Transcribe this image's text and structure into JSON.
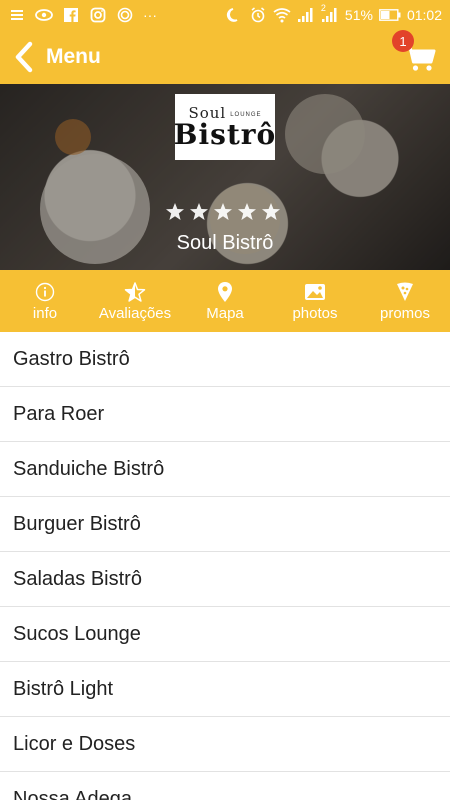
{
  "status_bar": {
    "battery_percent": "51%",
    "time": "01:02",
    "dots": "···",
    "sim_badge": "2"
  },
  "app_bar": {
    "title": "Menu",
    "cart_count": "1"
  },
  "hero": {
    "logo_top": "Soul",
    "logo_lounge": "LOUNGE",
    "logo_main": "Bistrô",
    "rating_stars": 5,
    "name": "Soul Bistrô"
  },
  "tabs": [
    {
      "label": "info",
      "icon": "info-icon"
    },
    {
      "label": "Avaliações",
      "icon": "star-rating-icon"
    },
    {
      "label": "Mapa",
      "icon": "map-pin-icon"
    },
    {
      "label": "photos",
      "icon": "photo-icon"
    },
    {
      "label": "promos",
      "icon": "pizza-icon"
    }
  ],
  "menu_items": [
    "Gastro Bistrô",
    "Para Roer",
    "Sanduiche Bistrô",
    "Burguer Bistrô",
    "Saladas Bistrô",
    "Sucos Lounge",
    "Bistrô Light",
    "Licor e Doses",
    "Nossa Adega"
  ],
  "colors": {
    "accent": "#f6c034",
    "badge": "#e2432a"
  }
}
